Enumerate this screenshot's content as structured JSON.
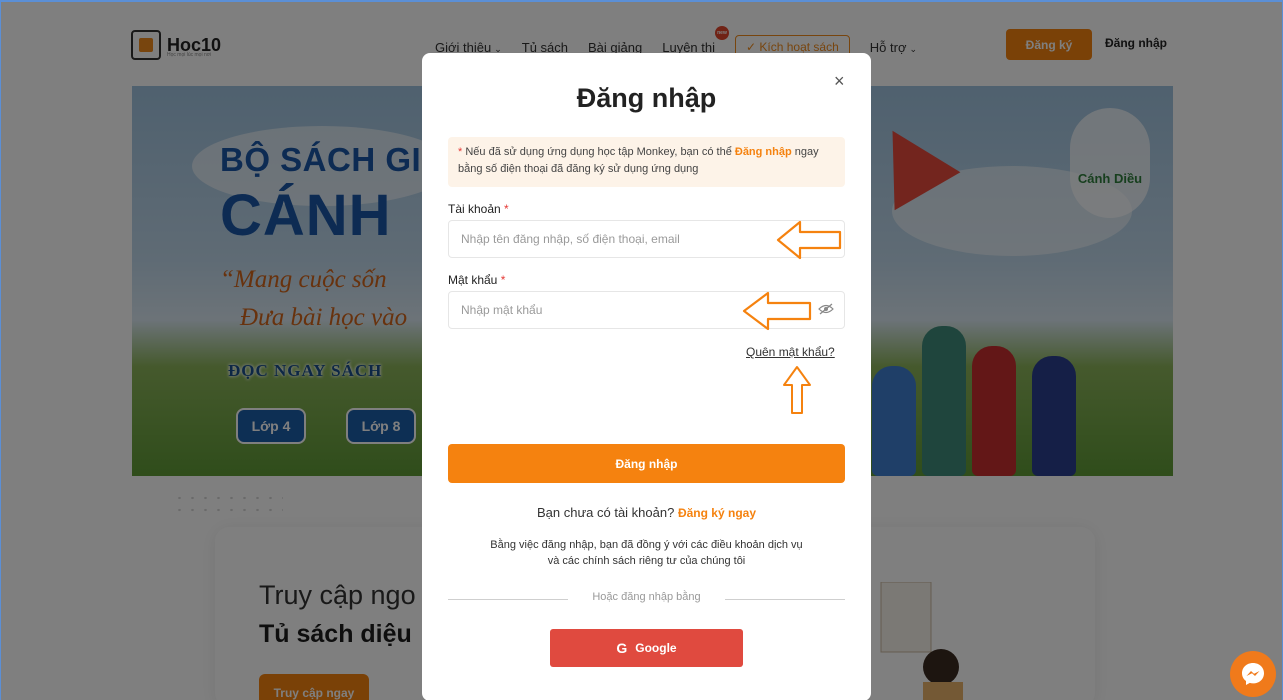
{
  "header": {
    "logo_text": "Hoc10",
    "logo_tagline": "Học mọi lúc mọi nơi",
    "nav": [
      {
        "label": "Giới thiệu",
        "dropdown": true
      },
      {
        "label": "Tủ sách",
        "dropdown": false
      },
      {
        "label": "Bài giảng",
        "dropdown": false
      },
      {
        "label": "Luyện thi",
        "dropdown": false,
        "badge": "new"
      }
    ],
    "activate_label": "✓ Kích hoạt sách",
    "support_label": "Hỗ trợ",
    "register_label": "Đăng ký",
    "login_label": "Đăng nhập"
  },
  "hero": {
    "title_line1": "BỘ SÁCH GIÁ",
    "title_line2": "CÁNH",
    "quote_line1": "“Mang cuộc sốn",
    "quote_line2": "Đưa bài học vào",
    "read_now": "ĐỌC NGAY SÁCH",
    "grades": [
      "Lớp 4",
      "Lớp 8"
    ],
    "brand": "Cánh Diều"
  },
  "access": {
    "line1": "Truy cập ngo",
    "line2": "Tủ sách diệu",
    "button": "Truy cập ngay"
  },
  "modal": {
    "close_symbol": "×",
    "title": "Đăng nhập",
    "notice_star": "*",
    "notice_text": " Nếu đã sử dụng ứng dụng học tập Monkey, bạn có thể ",
    "notice_link": "Đăng nhập",
    "notice_text2": " ngay bằng số điện thoại đã đăng ký sử dụng ứng dụng",
    "account_label": "Tài khoản",
    "account_placeholder": "Nhập tên đăng nhập, số điện thoại, email",
    "password_label": "Mật khẩu",
    "password_placeholder": "Nhập mật khẩu",
    "required_mark": "*",
    "forgot_label": "Quên mật khẩu?",
    "login_button": "Đăng nhập",
    "no_account_text": "Bạn chưa có tài khoản?",
    "register_now": "Đăng ký ngay",
    "terms_line1": "Bằng việc đăng nhập, bạn đã đồng ý với các điều khoản dịch vụ",
    "terms_line2": "và các chính sách riêng tư của chúng tôi",
    "divider_text": "Hoặc đăng nhập bằng",
    "google_icon": "G",
    "google_label": "Google"
  },
  "colors": {
    "accent": "#f5820f",
    "google": "#e04a3f",
    "brand_blue": "#1b57a7"
  }
}
